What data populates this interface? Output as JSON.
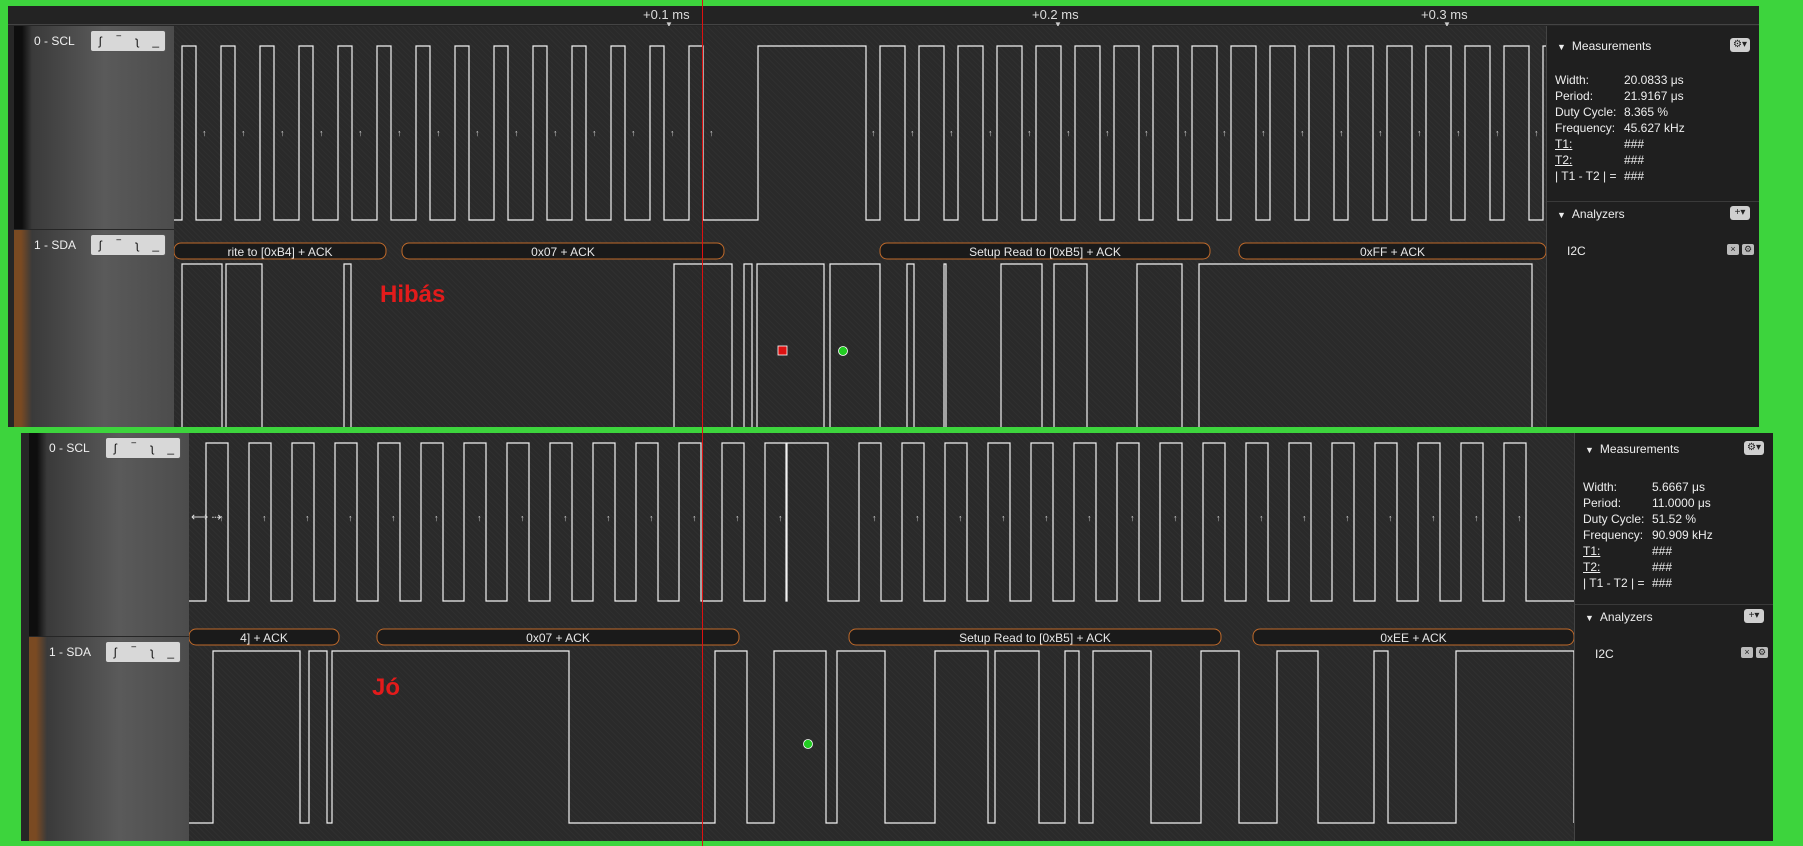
{
  "top": {
    "ruler_ticks": [
      "+0.1 ms",
      "+0.2 ms",
      "+0.3 ms"
    ],
    "channels": [
      {
        "name": "0 - SCL",
        "buttons": [
          "ʃ",
          "‾",
          "ʅ",
          "_"
        ]
      },
      {
        "name": "1 - SDA",
        "buttons": [
          "ʃ",
          "‾",
          "ʅ",
          "_"
        ]
      }
    ],
    "decoded": [
      "rite to [0xB4] + ACK",
      "0x07 + ACK",
      "Setup Read to [0xB5] + ACK",
      "0xFF + ACK"
    ],
    "annotation": "Hibás",
    "measurements": {
      "title": "Measurements",
      "rows": [
        {
          "k": "Width:",
          "v": "20.0833 μs"
        },
        {
          "k": "Period:",
          "v": "21.9167 μs"
        },
        {
          "k": "Duty Cycle:",
          "v": "8.365 %"
        },
        {
          "k": "Frequency:",
          "v": "45.627 kHz"
        },
        {
          "k": "T1:",
          "v": "###"
        },
        {
          "k": "T2:",
          "v": "###"
        },
        {
          "k": "| T1 - T2 | =",
          "v": "###"
        }
      ]
    },
    "analyzers": {
      "title": "Analyzers",
      "items": [
        "I2C"
      ]
    }
  },
  "bottom": {
    "channels": [
      {
        "name": "0 - SCL",
        "buttons": [
          "ʃ",
          "‾",
          "ʅ",
          "_"
        ]
      },
      {
        "name": "1 - SDA",
        "buttons": [
          "ʃ",
          "‾",
          "ʅ",
          "_"
        ]
      }
    ],
    "decoded": [
      "4] + ACK",
      "0x07 + ACK",
      "Setup Read to [0xB5] + ACK",
      "0xEE + ACK"
    ],
    "annotation": "Jó",
    "measurements": {
      "title": "Measurements",
      "rows": [
        {
          "k": "Width:",
          "v": "5.6667 μs"
        },
        {
          "k": "Period:",
          "v": "11.0000 μs"
        },
        {
          "k": "Duty Cycle:",
          "v": "51.52 %"
        },
        {
          "k": "Frequency:",
          "v": "90.909 kHz"
        },
        {
          "k": "T1:",
          "v": "###"
        },
        {
          "k": "T2:",
          "v": "###"
        },
        {
          "k": "| T1 - T2 | =",
          "v": "###"
        }
      ]
    },
    "analyzers": {
      "title": "Analyzers",
      "items": [
        "I2C"
      ]
    }
  },
  "colors": {
    "background": "#3dd43d",
    "annotation": "#e31b1b",
    "cursor": "#d11111",
    "marker_green": "#22cc22",
    "marker_red": "#dd1111"
  },
  "icons": [
    "gear-icon",
    "plus-icon",
    "close-icon",
    "expand-triangle-icon"
  ]
}
